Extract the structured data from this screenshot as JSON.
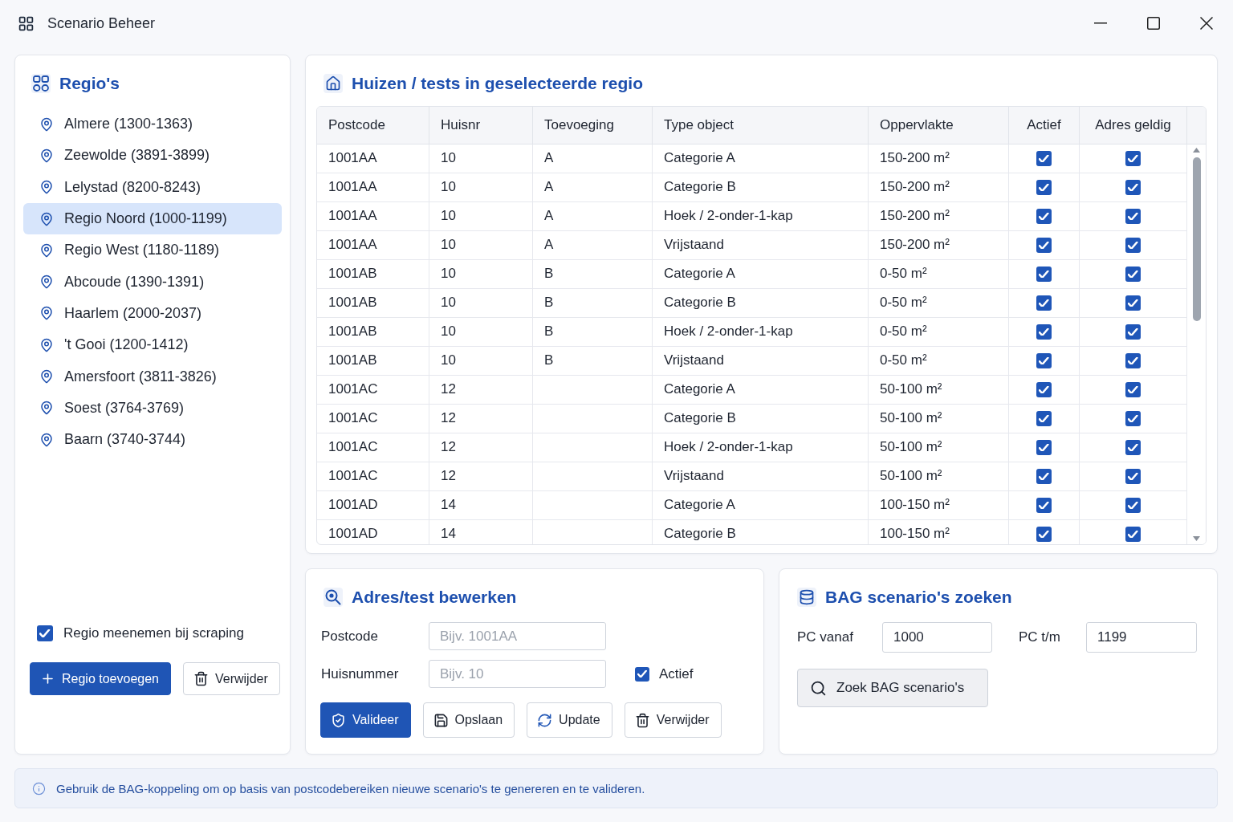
{
  "window": {
    "title": "Scenario Beheer"
  },
  "regions_panel": {
    "title": "Regio's",
    "items": [
      {
        "label": "Almere (1300-1363)",
        "selected": false
      },
      {
        "label": "Zeewolde (3891-3899)",
        "selected": false
      },
      {
        "label": "Lelystad (8200-8243)",
        "selected": false
      },
      {
        "label": "Regio Noord (1000-1199)",
        "selected": true
      },
      {
        "label": "Regio West (1180-1189)",
        "selected": false
      },
      {
        "label": "Abcoude (1390-1391)",
        "selected": false
      },
      {
        "label": "Haarlem (2000-2037)",
        "selected": false
      },
      {
        "label": "'t Gooi (1200-1412)",
        "selected": false
      },
      {
        "label": "Amersfoort (3811-3826)",
        "selected": false
      },
      {
        "label": "Soest (3764-3769)",
        "selected": false
      },
      {
        "label": "Baarn (3740-3744)",
        "selected": false
      }
    ],
    "include_in_scraping": {
      "label": "Regio meenemen bij scraping",
      "checked": true
    },
    "buttons": [
      {
        "label": "Regio toevoegen",
        "kind": "add",
        "primary": true
      },
      {
        "label": "Verwijder",
        "kind": "delete",
        "primary": false
      }
    ]
  },
  "houses_panel": {
    "title": "Huizen / tests in geselecteerde regio",
    "table": {
      "columns": [
        "Postcode",
        "Huisnr",
        "Toevoeging",
        "Type object",
        "Oppervlakte",
        "Actief",
        "Adres geldig"
      ],
      "rows": [
        {
          "postcode": "1001AA",
          "huisnr": "10",
          "toevoeging": "A",
          "type_object": "Categorie A",
          "oppervlakte": "150-200 m²",
          "actief": true,
          "adres_geldig": true
        },
        {
          "postcode": "1001AA",
          "huisnr": "10",
          "toevoeging": "A",
          "type_object": "Categorie B",
          "oppervlakte": "150-200 m²",
          "actief": true,
          "adres_geldig": true
        },
        {
          "postcode": "1001AA",
          "huisnr": "10",
          "toevoeging": "A",
          "type_object": "Hoek / 2-onder-1-kap",
          "oppervlakte": "150-200 m²",
          "actief": true,
          "adres_geldig": true
        },
        {
          "postcode": "1001AA",
          "huisnr": "10",
          "toevoeging": "A",
          "type_object": "Vrijstaand",
          "oppervlakte": "150-200 m²",
          "actief": true,
          "adres_geldig": true
        },
        {
          "postcode": "1001AB",
          "huisnr": "10",
          "toevoeging": "B",
          "type_object": "Categorie A",
          "oppervlakte": "0-50 m²",
          "actief": true,
          "adres_geldig": true
        },
        {
          "postcode": "1001AB",
          "huisnr": "10",
          "toevoeging": "B",
          "type_object": "Categorie B",
          "oppervlakte": "0-50 m²",
          "actief": true,
          "adres_geldig": true
        },
        {
          "postcode": "1001AB",
          "huisnr": "10",
          "toevoeging": "B",
          "type_object": "Hoek / 2-onder-1-kap",
          "oppervlakte": "0-50 m²",
          "actief": true,
          "adres_geldig": true
        },
        {
          "postcode": "1001AB",
          "huisnr": "10",
          "toevoeging": "B",
          "type_object": "Vrijstaand",
          "oppervlakte": "0-50 m²",
          "actief": true,
          "adres_geldig": true
        },
        {
          "postcode": "1001AC",
          "huisnr": "12",
          "type_object": "Categorie A",
          "oppervlakte": "50-100 m²",
          "actief": true,
          "adres_geldig": true
        },
        {
          "postcode": "1001AC",
          "huisnr": "12",
          "type_object": "Categorie B",
          "oppervlakte": "50-100 m²",
          "actief": true,
          "adres_geldig": true
        },
        {
          "postcode": "1001AC",
          "huisnr": "12",
          "type_object": "Hoek / 2-onder-1-kap",
          "oppervlakte": "50-100 m²",
          "actief": true,
          "adres_geldig": true
        },
        {
          "postcode": "1001AC",
          "huisnr": "12",
          "type_object": "Vrijstaand",
          "oppervlakte": "50-100 m²",
          "actief": true,
          "adres_geldig": true
        },
        {
          "postcode": "1001AD",
          "huisnr": "14",
          "type_object": "Categorie A",
          "oppervlakte": "100-150 m²",
          "actief": true,
          "adres_geldig": true
        },
        {
          "postcode": "1001AD",
          "huisnr": "14",
          "type_object": "Categorie B",
          "oppervlakte": "100-150 m²",
          "actief": true,
          "adres_geldig": true
        }
      ]
    }
  },
  "edit_panel": {
    "title": "Adres/test bewerken",
    "fields": [
      {
        "label": "Postcode",
        "placeholder": "Bijv. 1001AA"
      },
      {
        "label": "Huisnummer",
        "placeholder": "Bijv. 10"
      }
    ],
    "actief": {
      "label": "Actief",
      "checked": true
    },
    "buttons": [
      {
        "label": "Valideer",
        "kind": "validate",
        "primary": true
      },
      {
        "label": "Opslaan",
        "kind": "save",
        "primary": false
      },
      {
        "label": "Update",
        "kind": "update",
        "primary": false
      },
      {
        "label": "Verwijder",
        "kind": "delete",
        "primary": false
      }
    ]
  },
  "bag_panel": {
    "title": "BAG scenario's zoeken",
    "fields": [
      {
        "label": "PC vanaf",
        "value": "1000"
      },
      {
        "label": "PC t/m",
        "value": "1199"
      }
    ],
    "search_button": {
      "label": "Zoek BAG scenario's"
    }
  },
  "info_bar": {
    "text": "Gebruik de BAG-koppeling om op basis van postcodebereiken nieuwe scenario's te genereren en te valideren."
  }
}
